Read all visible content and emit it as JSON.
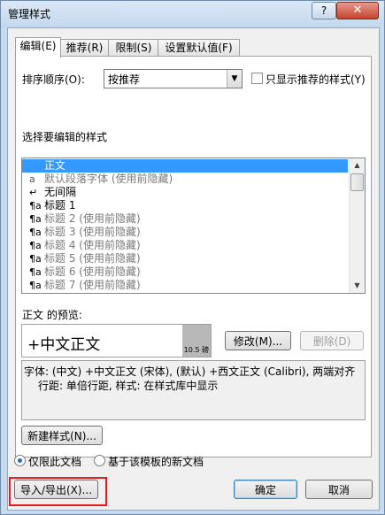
{
  "window": {
    "title": "管理样式",
    "help": "?",
    "close": "✕"
  },
  "tabs": [
    {
      "label": "编辑(E)",
      "active": true
    },
    {
      "label": "推荐(R)"
    },
    {
      "label": "限制(S)"
    },
    {
      "label": "设置默认值(F)"
    }
  ],
  "sort": {
    "label": "排序顺序(O):",
    "value": "按推荐"
  },
  "only_recommended": {
    "label": "只显示推荐的样式(Y)",
    "checked": false
  },
  "style_list": {
    "label": "选择要编辑的样式",
    "items": [
      {
        "icon": "",
        "text": "正文",
        "selected": true
      },
      {
        "icon": "a",
        "text": "默认段落字体  (使用前隐藏)",
        "muted": true
      },
      {
        "icon": "↵",
        "text": "无间隔"
      },
      {
        "icon": "¶a",
        "text": "标题 1"
      },
      {
        "icon": "¶a",
        "text": "标题 2  (使用前隐藏)",
        "muted": true
      },
      {
        "icon": "¶a",
        "text": "标题 3  (使用前隐藏)",
        "muted": true
      },
      {
        "icon": "¶a",
        "text": "标题 4  (使用前隐藏)",
        "muted": true
      },
      {
        "icon": "¶a",
        "text": "标题 5  (使用前隐藏)",
        "muted": true
      },
      {
        "icon": "¶a",
        "text": "标题 6  (使用前隐藏)",
        "muted": true
      },
      {
        "icon": "¶a",
        "text": "标题 7  (使用前隐藏)",
        "muted": true
      }
    ]
  },
  "preview": {
    "label": "正文 的预览:",
    "sample": "+中文正文",
    "size": "10.5 磅"
  },
  "buttons": {
    "modify": "修改(M)...",
    "delete": "删除(D)",
    "new_style": "新建样式(N)...",
    "import_export": "导入/导出(X)...",
    "ok": "确定",
    "cancel": "取消"
  },
  "description": {
    "line1": "字体: (中文) +中文正文 (宋体), (默认) +西文正文 (Calibri), 两端对齐",
    "line2": "行距: 单倍行距, 样式: 在样式库中显示"
  },
  "scope": {
    "option1": "仅限此文档",
    "option2": "基于该模板的新文档",
    "selected": 1
  },
  "colors": {
    "selection": "#3399ff",
    "highlight_border": "#e61b1b"
  }
}
